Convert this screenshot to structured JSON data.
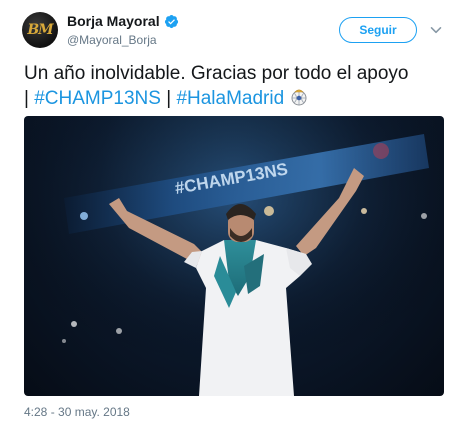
{
  "user": {
    "avatar_text": "BM",
    "display_name": "Borja Mayoral",
    "handle": "@Mayoral_Borja",
    "verified": true
  },
  "actions": {
    "follow_label": "Seguir"
  },
  "tweet": {
    "line1": "Un año inolvidable. Gracias por todo el apoyo",
    "separator_1": "|",
    "hashtag_1": "#CHAMP13NS",
    "separator_2": "|",
    "hashtag_2": "#HalaMadrid",
    "emoji_icon": "real-madrid-ball-icon"
  },
  "photo": {
    "banner_text": "#CHAMP13NS"
  },
  "meta": {
    "timestamp": "4:28 - 30 may. 2018"
  },
  "colors": {
    "link": "#1b95e0",
    "follow_accent": "#1da1f2",
    "muted": "#657786",
    "text": "#14171a"
  }
}
